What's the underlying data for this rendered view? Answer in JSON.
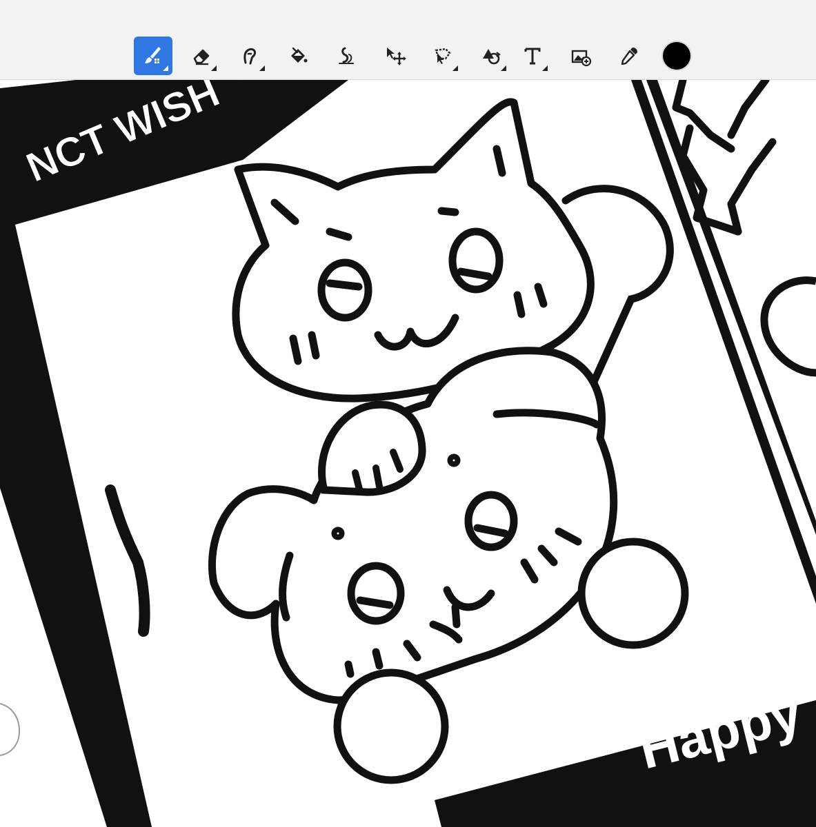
{
  "toolbar": {
    "tools": [
      {
        "name": "brush",
        "active": true
      },
      {
        "name": "eraser",
        "active": false
      },
      {
        "name": "smudge",
        "active": false
      },
      {
        "name": "fill",
        "active": false
      },
      {
        "name": "adjust",
        "active": false
      },
      {
        "name": "move",
        "active": false
      },
      {
        "name": "lasso",
        "active": false
      },
      {
        "name": "transform",
        "active": false
      },
      {
        "name": "text",
        "active": false
      },
      {
        "name": "image",
        "active": false
      },
      {
        "name": "eyedropper",
        "active": false
      }
    ],
    "active_color": "#000000",
    "accent_color": "#2f78e3"
  },
  "canvas": {
    "top_banner_text": "☆NCT WISH☆",
    "bottom_banner_text": "Happy Bi"
  }
}
